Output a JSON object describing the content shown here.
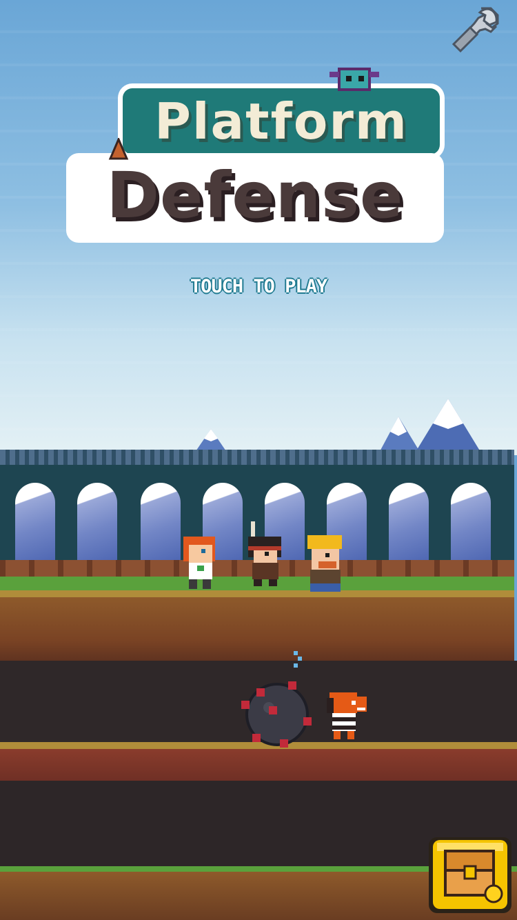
{
  "title": {
    "line1": "Platform",
    "line2": "Defense"
  },
  "prompt": "TOUCH TO PLAY",
  "icons": {
    "settings": "wrench-icon",
    "treasure": "treasure-chest-icon"
  },
  "characters": [
    "redhead-hero",
    "feathered-hero",
    "miner-hero",
    "orange-lizard-enemy",
    "spiked-bomb-enemy"
  ],
  "colors": {
    "title_band": "#1f7a78",
    "prompt_outline": "#1f7a90",
    "chest_button": "#f5c400"
  }
}
